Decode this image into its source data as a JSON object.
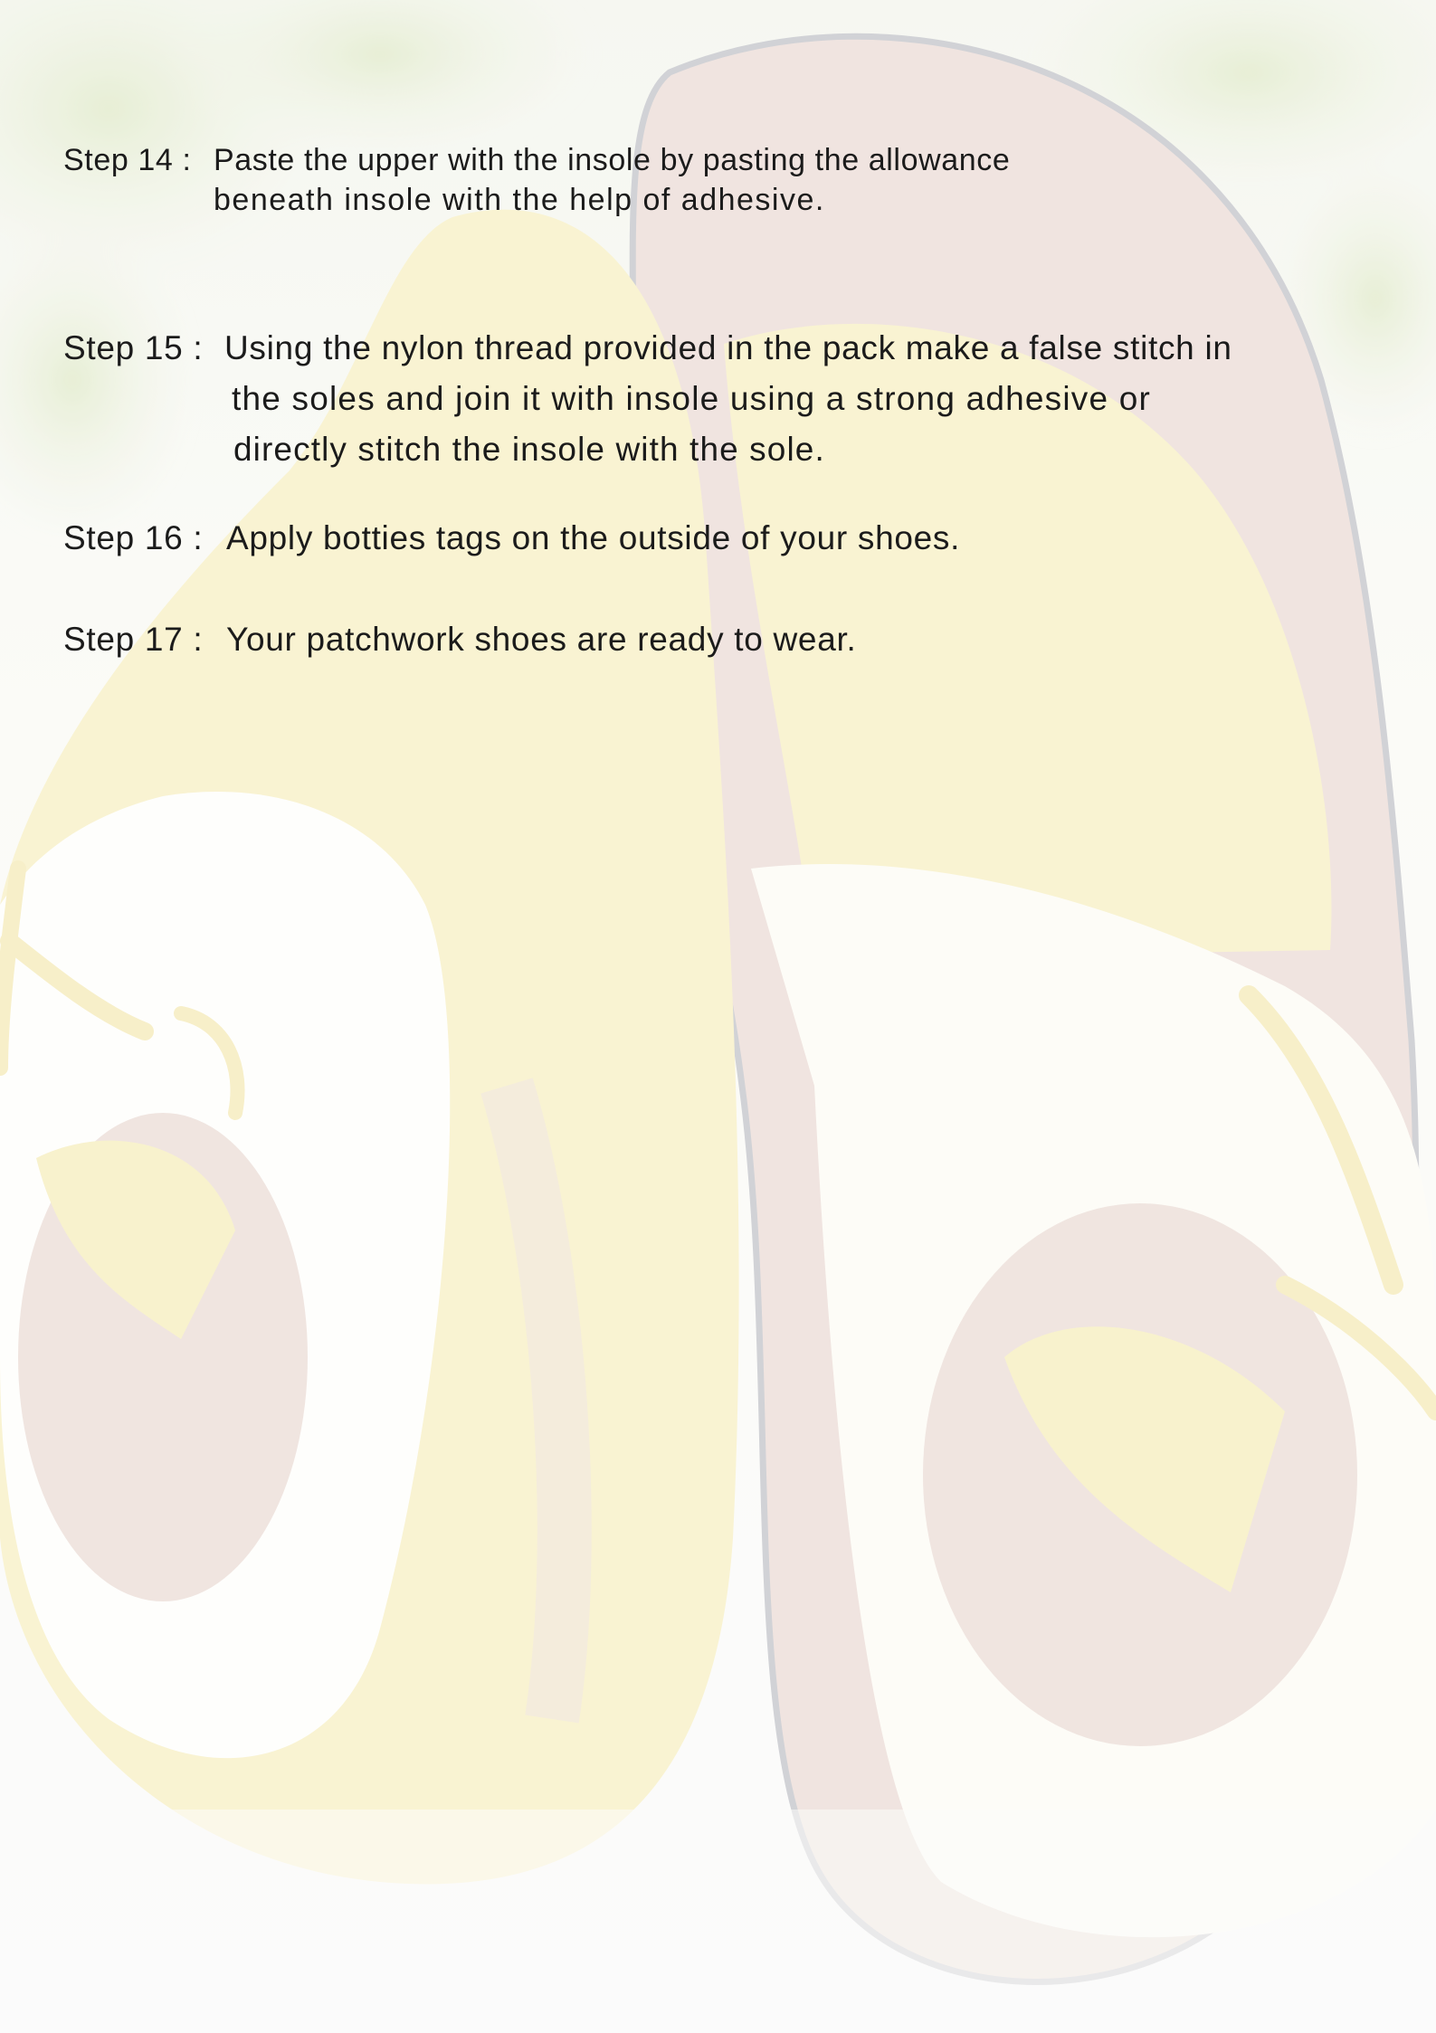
{
  "steps": [
    {
      "label": "Step 14 :",
      "lines": [
        "Paste the upper with the insole by pasting the allowance",
        "beneath insole with the help of adhesive."
      ]
    },
    {
      "label": "Step 15 :",
      "lines": [
        "Using the nylon thread provided in the pack make a false stitch in",
        "the soles and join it with insole using a strong adhesive or",
        "directly stitch the insole with the sole."
      ]
    },
    {
      "label": "Step 16 :",
      "lines": [
        "Apply botties tags on the outside of your shoes."
      ]
    },
    {
      "label": "Step 17 :",
      "lines": [
        "Your patchwork shoes are ready to wear."
      ]
    }
  ],
  "background": {
    "image": "faded-patchwork-baby-shoes-photo",
    "colors": {
      "page": "#fbfbf9",
      "felt_yellow": "#f7f0c4",
      "felt_brown": "#ecdcd6",
      "felt_white": "#fefefd",
      "leaf_green": "#e6edd3",
      "outline": "#c4c5cb"
    }
  }
}
